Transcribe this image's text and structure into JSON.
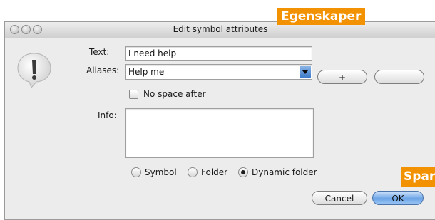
{
  "callouts": {
    "top": "Egenskaper",
    "bottom": "Spara"
  },
  "window": {
    "title": "Edit symbol attributes"
  },
  "form": {
    "text_label": "Text:",
    "text_value": "I need help",
    "aliases_label": "Aliases:",
    "aliases_value": "Help me",
    "add_label": "+",
    "remove_label": "-",
    "no_space_label": "No space after",
    "info_label": "Info:",
    "info_value": "",
    "type_options": [
      {
        "label": "Symbol",
        "selected": false
      },
      {
        "label": "Folder",
        "selected": false
      },
      {
        "label": "Dynamic folder",
        "selected": true
      }
    ]
  },
  "buttons": {
    "cancel": "Cancel",
    "ok": "OK"
  },
  "icons": {
    "alert": "exclamation-speech-bubble-icon"
  },
  "colors": {
    "callout": "#f39200",
    "default_button": "#6aa3e6"
  }
}
